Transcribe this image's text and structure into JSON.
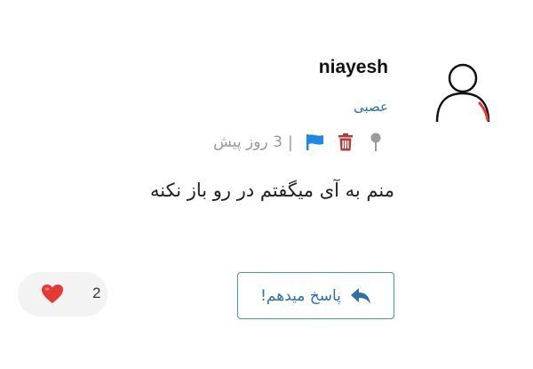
{
  "comment": {
    "username": "niayesh",
    "mood": "عصبی",
    "time_ago": "3 روز پیش",
    "separator": "|",
    "text": "منم به آی میگفتم در رو باز نکنه",
    "likes_count": "2",
    "reply_label": "پاسخ میدهم!"
  },
  "icons": {
    "avatar": "user-avatar-icon",
    "pin": "pin-icon",
    "delete": "trash-icon",
    "report": "flag-icon",
    "like": "heart-icon",
    "reply": "reply-arrow-icon"
  },
  "colors": {
    "accent_blue": "#2d6fa8",
    "flag_blue": "#1e88e5",
    "trash_red": "#b23b3b",
    "heart_red": "#e53935",
    "muted_gray": "#9a9a9a",
    "pill_bg": "#f3f3f3"
  }
}
